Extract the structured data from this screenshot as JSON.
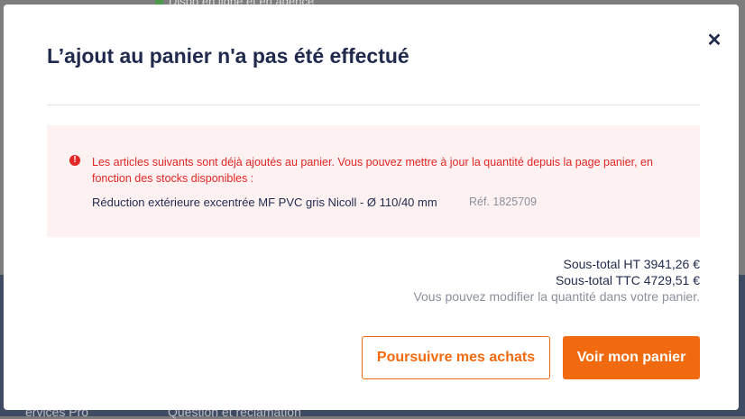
{
  "background": {
    "stock_status": "Dispo en ligne et en agence",
    "footer_left": "ervices Pro",
    "footer_mid": "Question et réclamation"
  },
  "modal": {
    "title": "L’ajout au panier n'a pas été effectué",
    "close_icon": "close-icon",
    "alert": {
      "icon": "exclamation-circle-icon",
      "message": "Les articles suivants sont déjà ajoutés au panier. Vous pouvez mettre à jour la quantité depuis la page panier, en fonction des stocks disponibles :",
      "product_name": "Réduction extérieure excentrée MF PVC gris Nicoll - Ø 110/40 mm",
      "product_ref": "Réf. 1825709"
    },
    "subtotal_ht": "Sous-total HT 3941,26 €",
    "subtotal_ttc": "Sous-total TTC 4729,51 €",
    "hint": "Vous pouvez modifier la quantité dans votre panier.",
    "continue_label": "Poursuivre mes achats",
    "cart_label": "Voir mon panier"
  },
  "colors": {
    "accent": "#f26a0f",
    "title": "#1f2a4d",
    "error": "#e32626",
    "alert_bg": "#fdf1f1"
  }
}
